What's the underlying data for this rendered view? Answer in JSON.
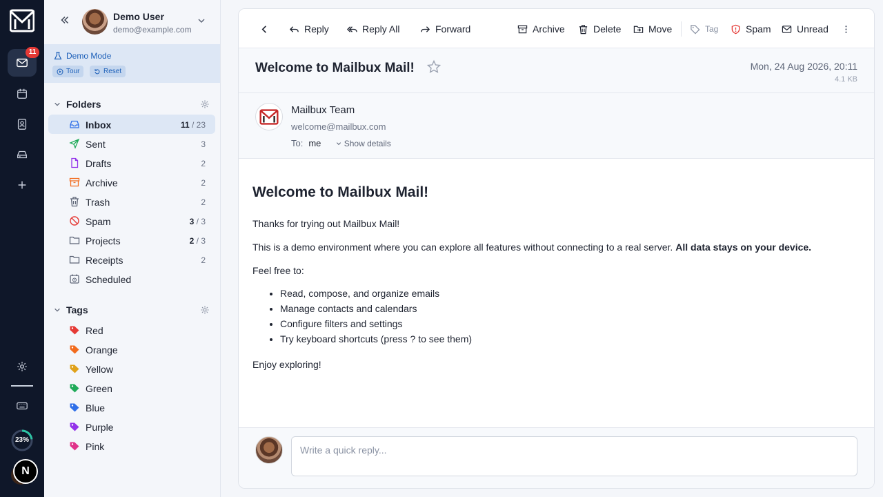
{
  "rail": {
    "inbox_badge": "11",
    "storage": "23%",
    "profile_initial": "N"
  },
  "user": {
    "name": "Demo User",
    "email": "demo@example.com"
  },
  "demo": {
    "title": "Demo Mode",
    "tour": "Tour",
    "reset": "Reset"
  },
  "folders": {
    "heading": "Folders",
    "items": [
      {
        "name": "Inbox",
        "unread": "11",
        "total": "23"
      },
      {
        "name": "Sent",
        "count": "3"
      },
      {
        "name": "Drafts",
        "count": "2"
      },
      {
        "name": "Archive",
        "count": "2"
      },
      {
        "name": "Trash",
        "count": "2"
      },
      {
        "name": "Spam",
        "unread": "3",
        "total": "3"
      },
      {
        "name": "Projects",
        "unread": "2",
        "total": "3"
      },
      {
        "name": "Receipts",
        "count": "2"
      },
      {
        "name": "Scheduled"
      }
    ]
  },
  "tags": {
    "heading": "Tags",
    "items": [
      {
        "name": "Red",
        "color": "#e53935"
      },
      {
        "name": "Orange",
        "color": "#f26b1d"
      },
      {
        "name": "Yellow",
        "color": "#e0a21b"
      },
      {
        "name": "Green",
        "color": "#1faa59"
      },
      {
        "name": "Blue",
        "color": "#2f6fe8"
      },
      {
        "name": "Purple",
        "color": "#9333ea"
      },
      {
        "name": "Pink",
        "color": "#e0338a"
      }
    ]
  },
  "toolbar": {
    "reply": "Reply",
    "reply_all": "Reply All",
    "forward": "Forward",
    "archive": "Archive",
    "delete": "Delete",
    "move": "Move",
    "tag": "Tag",
    "spam": "Spam",
    "unread": "Unread"
  },
  "message": {
    "subject": "Welcome to Mailbux Mail!",
    "date": "Mon, 24 Aug 2026, 20:11",
    "size": "4.1 KB",
    "sender_name": "Mailbux Team",
    "sender_email": "welcome@mailbux.com",
    "to_label": "To:",
    "to": "me",
    "show_details": "Show details",
    "body": {
      "heading": "Welcome to Mailbux Mail!",
      "p1": "Thanks for trying out Mailbux Mail!",
      "p2": "This is a demo environment where you can explore all features without connecting to a real server.",
      "p2_bold": "All data stays on your device.",
      "p3": "Feel free to:",
      "list": [
        "Read, compose, and organize emails",
        "Manage contacts and calendars",
        "Configure filters and settings",
        "Try keyboard shortcuts (press ? to see them)"
      ],
      "p4": "Enjoy exploring!"
    }
  },
  "reply": {
    "placeholder": "Write a quick reply..."
  },
  "colors": {
    "accent": "#1c5fb8",
    "rail": "#0f1729",
    "spam": "#e53935"
  }
}
